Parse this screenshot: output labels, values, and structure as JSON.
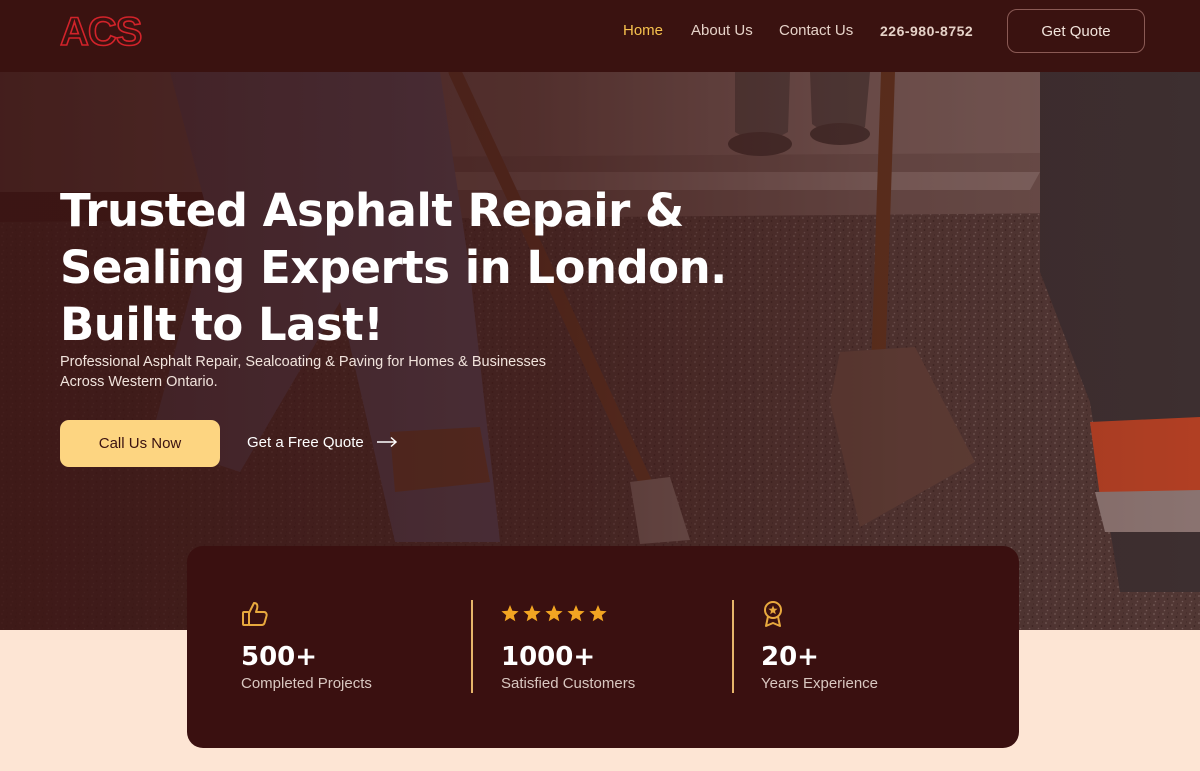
{
  "brand": {
    "logo_text": "ACS",
    "logo_color": "#d2232a"
  },
  "nav": {
    "items": [
      {
        "label": "Home",
        "active": true
      },
      {
        "label": "About Us",
        "active": false
      },
      {
        "label": "Contact Us",
        "active": false
      }
    ],
    "phone": "226-980-8752",
    "quote_button": "Get Quote"
  },
  "hero": {
    "title": "Trusted Asphalt Repair & Sealing Experts in London. Built to Last!",
    "subtitle": "Professional Asphalt Repair, Sealcoating & Paving for Homes & Businesses Across Western Ontario.",
    "primary_cta": "Call Us Now",
    "secondary_cta": "Get a Free Quote"
  },
  "stats": [
    {
      "icon": "thumbs-up-icon",
      "value": "500+",
      "label": "Completed Projects"
    },
    {
      "icon": "five-stars-icon",
      "value": "1000+",
      "label": "Satisfied Customers",
      "rating": 5
    },
    {
      "icon": "award-medal-icon",
      "value": "20+",
      "label": "Years Experience"
    }
  ],
  "colors": {
    "header_bg": "#3a1210",
    "accent": "#f6c14e",
    "cta_bg": "#fdd581",
    "card_bg": "#3a1010",
    "page_bg": "#fde5d4"
  }
}
